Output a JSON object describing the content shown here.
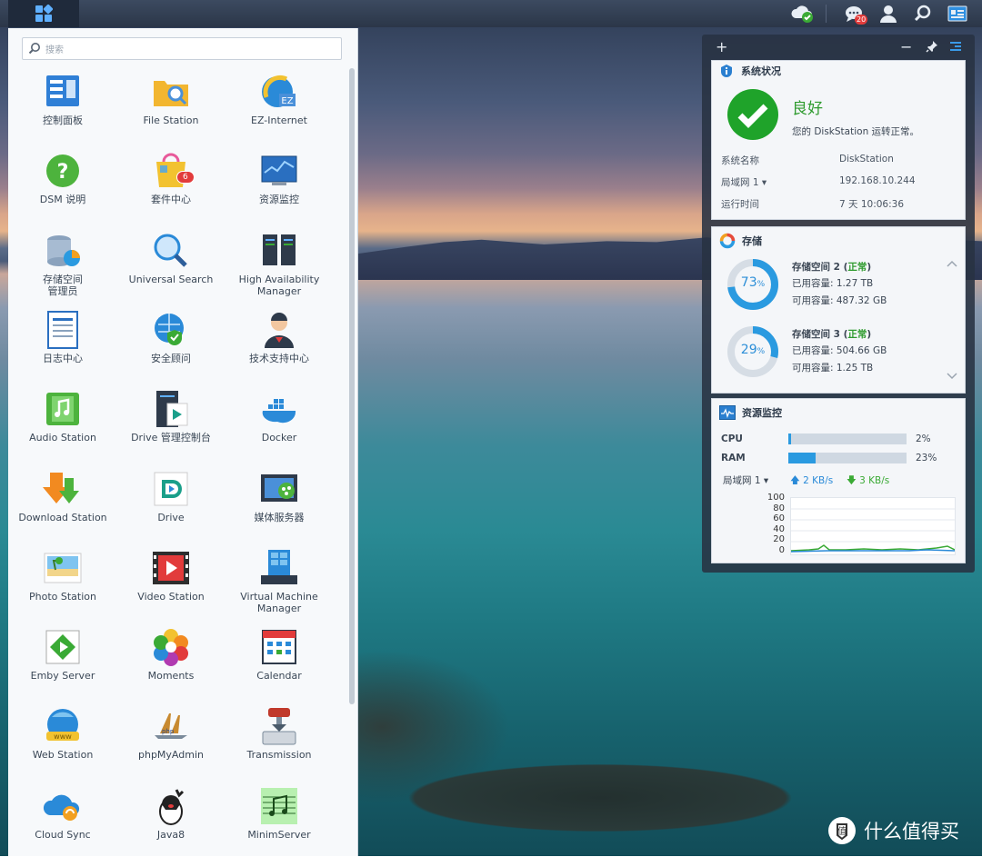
{
  "taskbar": {
    "start_icon": "main-menu-grid-icon",
    "icons": [
      "cloud-sync-status-icon",
      "notifications-icon",
      "user-icon",
      "search-icon",
      "widgets-icon"
    ],
    "notification_count": "20"
  },
  "menu": {
    "search_placeholder": "搜索",
    "apps": [
      {
        "label": "控制面板",
        "icon": "control-panel-icon"
      },
      {
        "label": "File Station",
        "icon": "file-station-icon"
      },
      {
        "label": "EZ-Internet",
        "icon": "ez-internet-icon"
      },
      {
        "label": "DSM 说明",
        "icon": "dsm-help-icon"
      },
      {
        "label": "套件中心",
        "icon": "package-center-icon",
        "badge": "6"
      },
      {
        "label": "资源监控",
        "icon": "resource-monitor-icon"
      },
      {
        "label": "存储空间\n管理员",
        "icon": "storage-manager-icon"
      },
      {
        "label": "Universal Search",
        "icon": "universal-search-icon"
      },
      {
        "label": "High Availability\nManager",
        "icon": "high-availability-icon"
      },
      {
        "label": "日志中心",
        "icon": "log-center-icon"
      },
      {
        "label": "安全顾问",
        "icon": "security-advisor-icon"
      },
      {
        "label": "技术支持中心",
        "icon": "support-center-icon"
      },
      {
        "label": "Audio Station",
        "icon": "audio-station-icon"
      },
      {
        "label": "Drive 管理控制台",
        "icon": "drive-admin-icon"
      },
      {
        "label": "Docker",
        "icon": "docker-icon"
      },
      {
        "label": "Download Station",
        "icon": "download-station-icon"
      },
      {
        "label": "Drive",
        "icon": "drive-icon"
      },
      {
        "label": "媒体服务器",
        "icon": "media-server-icon"
      },
      {
        "label": "Photo Station",
        "icon": "photo-station-icon"
      },
      {
        "label": "Video Station",
        "icon": "video-station-icon"
      },
      {
        "label": "Virtual Machine\nManager",
        "icon": "vmm-icon"
      },
      {
        "label": "Emby Server",
        "icon": "emby-icon"
      },
      {
        "label": "Moments",
        "icon": "moments-icon"
      },
      {
        "label": "Calendar",
        "icon": "calendar-icon"
      },
      {
        "label": "Web Station",
        "icon": "web-station-icon"
      },
      {
        "label": "phpMyAdmin",
        "icon": "phpmyadmin-icon"
      },
      {
        "label": "Transmission",
        "icon": "transmission-icon"
      },
      {
        "label": "Cloud Sync",
        "icon": "cloud-sync-icon"
      },
      {
        "label": "Java8",
        "icon": "java-icon"
      },
      {
        "label": "MinimServer",
        "icon": "minimserver-icon"
      }
    ]
  },
  "widgets": {
    "toolbar": {
      "add": "+",
      "minimize": "−"
    },
    "system_status": {
      "title": "系统状况",
      "status": "良好",
      "message": "您的 DiskStation 运转正常。",
      "rows": [
        {
          "label": "系统名称",
          "value": "DiskStation"
        },
        {
          "label": "局域网 1 ▾",
          "value": "192.168.10.244"
        },
        {
          "label": "运行时间",
          "value": "7 天 10:06:36"
        }
      ]
    },
    "storage": {
      "title": "存储",
      "volumes": [
        {
          "name": "存储空间 2",
          "status": "正常",
          "percent": 73,
          "used_label": "已用容量:",
          "used": "1.27 TB",
          "avail_label": "可用容量:",
          "avail": "487.32 GB"
        },
        {
          "name": "存储空间 3",
          "status": "正常",
          "percent": 29,
          "used_label": "已用容量:",
          "used": "504.66 GB",
          "avail_label": "可用容量:",
          "avail": "1.25 TB"
        }
      ]
    },
    "resource_monitor": {
      "title": "资源监控",
      "cpu_label": "CPU",
      "cpu_value": "2%",
      "cpu_fraction": 0.02,
      "ram_label": "RAM",
      "ram_value": "23%",
      "ram_fraction": 0.23,
      "lan_label": "局域网 1 ▾",
      "upload": "2 KB/s",
      "download": "3 KB/s",
      "chart_ticks": [
        "100",
        "80",
        "60",
        "40",
        "20",
        "0"
      ],
      "colors": {
        "upload": "#2a8ad8",
        "download": "#3aaa35"
      }
    }
  },
  "watermark": "什么值得买"
}
